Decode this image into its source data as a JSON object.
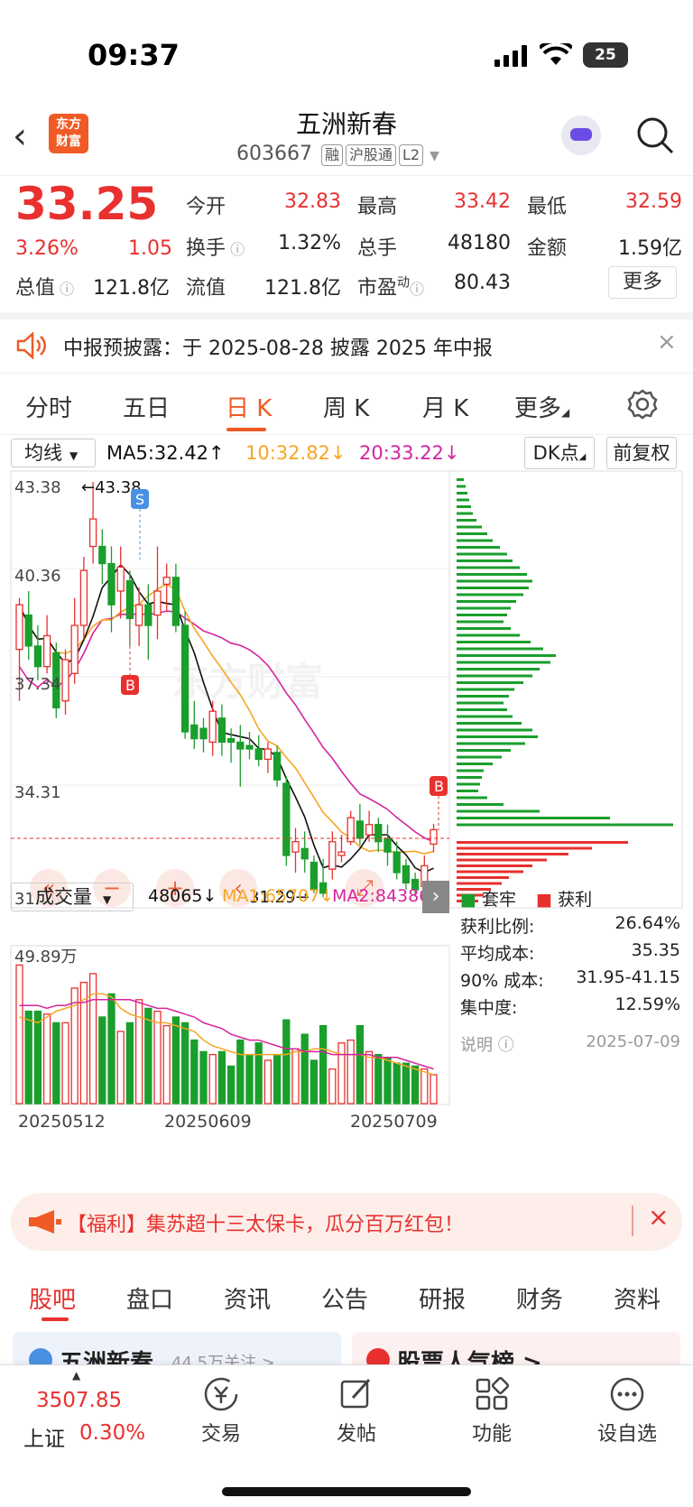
{
  "status": {
    "time": "09:37",
    "battery": "25"
  },
  "header": {
    "logo_line1": "东方",
    "logo_line2": "财富",
    "stock_name": "五洲新春",
    "code": "603667",
    "tags": [
      "融",
      "沪股通",
      "L2"
    ]
  },
  "quote": {
    "price": "33.25",
    "change_pct": "3.26%",
    "change": "1.05",
    "open_label": "今开",
    "open": "32.83",
    "high_label": "最高",
    "high": "33.42",
    "low_label": "最低",
    "low": "32.59",
    "turnover_label": "换手",
    "turnover": "1.32%",
    "volume_label": "总手",
    "volume": "48180",
    "amount_label": "金额",
    "amount": "1.59亿",
    "mktcap_label": "总值",
    "mktcap": "121.8亿",
    "float_label": "流值",
    "float": "121.8亿",
    "pe_label": "市盈",
    "pe_sup": "动",
    "pe": "80.43",
    "more": "更多"
  },
  "notice": {
    "text": "中报预披露：于 2025-08-28 披露 2025 年中报"
  },
  "tabs": [
    "分时",
    "五日",
    "日 K",
    "周 K",
    "月 K",
    "更多"
  ],
  "active_tab": "日 K",
  "kline": {
    "indicator": "均线",
    "ma5": "MA5:32.42↑",
    "ma10": "10:32.82↓",
    "ma20": "20:33.22↓",
    "dk": "DK点",
    "adjust": "前复权",
    "y_labels": [
      "43.38",
      "40.36",
      "37.34",
      "34.31",
      "31.29"
    ],
    "high_mark": "←43.38",
    "low_mark": "31.29→",
    "signal_s": "S",
    "signal_b": "B",
    "watermark": "东方财富",
    "colors": {
      "up": "#e8312f",
      "down": "#1a9e2c",
      "ma5": "#111111",
      "ma10": "#f5a623",
      "ma20": "#d6249f"
    }
  },
  "volume": {
    "indicator": "成交量",
    "value": "48065↓",
    "ma1": "MA1:65707↓",
    "ma2": "MA2:84386↓",
    "max_label": "49.89万",
    "dates": [
      "20250512",
      "20250609",
      "20250709"
    ]
  },
  "chips": {
    "legend_trapped": "套牢",
    "legend_profit": "获利",
    "rows": [
      {
        "label": "获利比例:",
        "value": "26.64%"
      },
      {
        "label": "平均成本:",
        "value": "35.35"
      },
      {
        "label": "90% 成本:",
        "value": "31.95-41.15"
      },
      {
        "label": "集中度:",
        "value": "12.59%"
      }
    ],
    "note_label": "说明",
    "date": "2025-07-09"
  },
  "promo": {
    "text": "【福利】集苏超十三太保卡，瓜分百万红包！"
  },
  "subtabs": [
    "股吧",
    "盘口",
    "资讯",
    "公告",
    "研报",
    "财务",
    "资料"
  ],
  "active_subtab": "股吧",
  "peek": {
    "left": "五洲新春",
    "left_sub": "44.5万关注 >",
    "right": "股票人气榜 >"
  },
  "bottom_nav": {
    "index_value": "3507.85",
    "index_name": "上证",
    "index_change": "0.30%",
    "items": [
      "交易",
      "发帖",
      "功能",
      "设自选"
    ]
  },
  "controls": [
    "«",
    "−",
    "+",
    "‹",
    "⤢"
  ],
  "candles": [
    [
      38.5,
      39.8,
      40.0,
      37.0
    ],
    [
      39.5,
      38.6,
      40.2,
      38.2
    ],
    [
      38.6,
      38.0,
      39.2,
      37.6
    ],
    [
      38.0,
      38.9,
      39.5,
      37.8
    ],
    [
      38.4,
      36.8,
      38.7,
      36.5
    ],
    [
      37.0,
      38.2,
      38.5,
      36.6
    ],
    [
      37.8,
      39.2,
      40.0,
      37.5
    ],
    [
      39.2,
      40.8,
      41.2,
      38.8
    ],
    [
      41.5,
      42.3,
      43.38,
      41.0
    ],
    [
      41.5,
      41.0,
      42.0,
      40.4
    ],
    [
      41.0,
      39.8,
      41.5,
      39.0
    ],
    [
      40.2,
      40.9,
      41.5,
      39.4
    ],
    [
      40.5,
      39.4,
      40.8,
      38.6
    ],
    [
      39.2,
      39.8,
      40.3,
      38.6
    ],
    [
      39.8,
      39.2,
      40.4,
      38.2
    ],
    [
      39.5,
      40.2,
      41.5,
      38.8
    ],
    [
      40.4,
      40.6,
      41.0,
      39.6
    ],
    [
      40.6,
      39.2,
      41.0,
      39.0
    ],
    [
      39.2,
      36.1,
      39.6,
      35.9
    ],
    [
      36.3,
      35.9,
      37.0,
      35.6
    ],
    [
      36.2,
      35.9,
      36.5,
      35.5
    ],
    [
      35.8,
      36.7,
      37.0,
      35.4
    ],
    [
      36.5,
      35.8,
      36.9,
      35.4
    ],
    [
      35.9,
      35.8,
      36.2,
      35.2
    ],
    [
      35.8,
      35.6,
      36.3,
      34.5
    ],
    [
      35.7,
      35.6,
      36.1,
      35.3
    ],
    [
      35.6,
      35.3,
      36.0,
      35.1
    ],
    [
      35.3,
      35.6,
      35.8,
      34.9
    ],
    [
      35.5,
      34.7,
      35.7,
      34.5
    ],
    [
      34.6,
      32.5,
      34.8,
      32.2
    ],
    [
      32.6,
      32.9,
      33.3,
      32.0
    ],
    [
      32.7,
      32.4,
      33.2,
      32.0
    ],
    [
      32.3,
      31.5,
      32.5,
      31.4
    ],
    [
      31.7,
      31.4,
      32.4,
      31.29
    ],
    [
      32.1,
      32.9,
      33.2,
      31.8
    ],
    [
      32.5,
      32.6,
      33.1,
      32.3
    ],
    [
      32.9,
      33.6,
      33.8,
      32.8
    ],
    [
      33.5,
      33.0,
      34.0,
      32.8
    ],
    [
      33.1,
      33.4,
      33.8,
      32.9
    ],
    [
      33.4,
      32.9,
      33.6,
      32.6
    ],
    [
      33.0,
      32.6,
      33.4,
      32.2
    ],
    [
      32.6,
      32.0,
      32.9,
      31.8
    ],
    [
      32.2,
      31.7,
      32.4,
      31.5
    ],
    [
      31.8,
      31.5,
      32.0,
      31.3
    ],
    [
      31.6,
      32.2,
      32.5,
      31.5
    ],
    [
      32.83,
      33.25,
      33.42,
      32.59
    ]
  ],
  "volumes": [
    48,
    32,
    32,
    31,
    28,
    28,
    40,
    42,
    45,
    30,
    38,
    25,
    28,
    36,
    33,
    32,
    27,
    30,
    28,
    22,
    18,
    17,
    18,
    13,
    22,
    17,
    21,
    15,
    17,
    29,
    19,
    24,
    15,
    27,
    12,
    21,
    22,
    27,
    18,
    17,
    16,
    14,
    14,
    13,
    12,
    10
  ],
  "volume_ma1": [
    30,
    29,
    28,
    30,
    32,
    33,
    34,
    36,
    38,
    38,
    37,
    33,
    31,
    30,
    29,
    28,
    28,
    27,
    26,
    25,
    22,
    20,
    19,
    18,
    17,
    17,
    17,
    17,
    17,
    17,
    18,
    18,
    19,
    19,
    18,
    17,
    17,
    17,
    16,
    16,
    15,
    14,
    13,
    12,
    11,
    10
  ],
  "volume_ma2": [
    34,
    34,
    34,
    33,
    34,
    34,
    35,
    35,
    36,
    36,
    36,
    36,
    36,
    35,
    34,
    33,
    33,
    32,
    31,
    30,
    28,
    27,
    26,
    24,
    23,
    22,
    22,
    21,
    20,
    19,
    19,
    18,
    18,
    18,
    17,
    17,
    17,
    17,
    17,
    16,
    16,
    16,
    15,
    14,
    13,
    12
  ],
  "chip_bars_green": [
    8,
    10,
    12,
    14,
    16,
    18,
    22,
    28,
    34,
    40,
    48,
    56,
    62,
    70,
    78,
    84,
    80,
    74,
    66,
    60,
    56,
    52,
    60,
    70,
    82,
    96,
    110,
    104,
    92,
    84,
    74,
    64,
    58,
    52,
    56,
    62,
    72,
    84,
    90,
    76,
    60,
    50,
    40,
    30,
    28,
    26,
    24,
    34,
    52,
    92,
    170,
    240
  ],
  "chip_bars_red": [
    190,
    150,
    124,
    100,
    84,
    74,
    58,
    50,
    38,
    30,
    24
  ]
}
